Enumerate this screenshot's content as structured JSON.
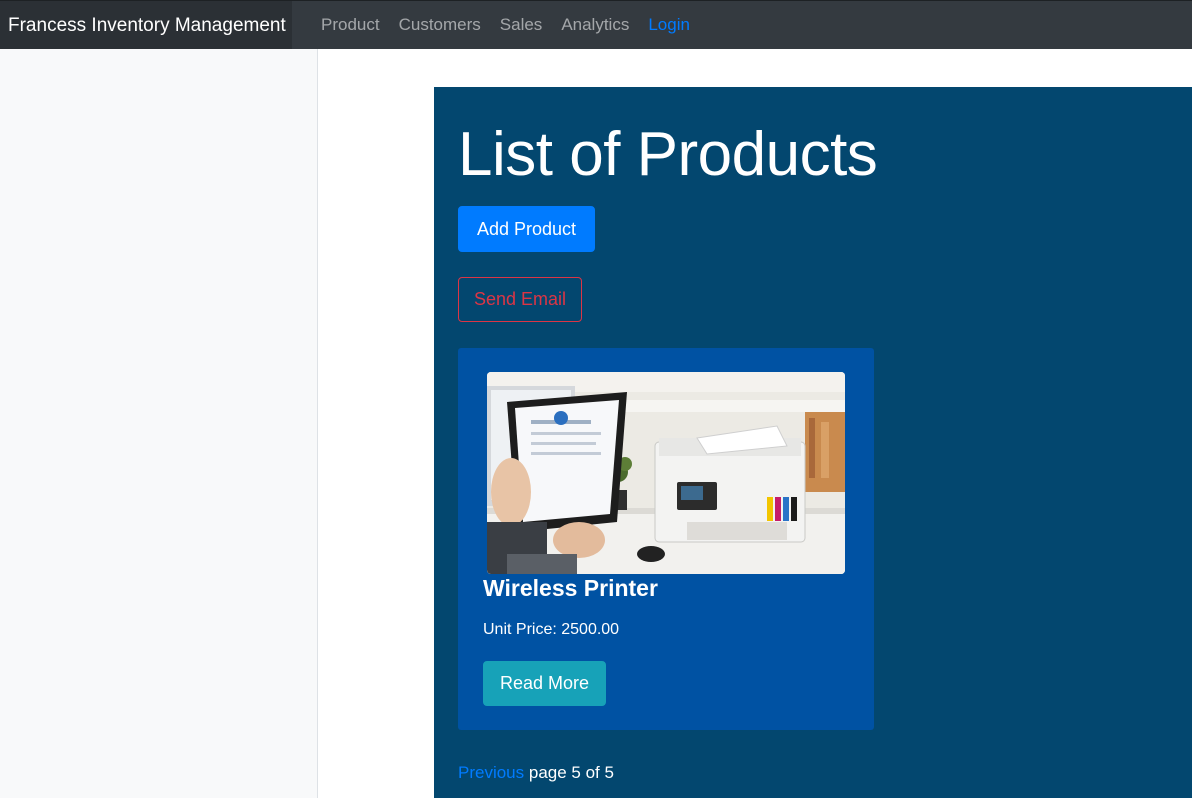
{
  "navbar": {
    "brand": "Francess Inventory Management",
    "links": [
      "Product",
      "Customers",
      "Sales",
      "Analytics"
    ],
    "login": "Login"
  },
  "main": {
    "title": "List of Products",
    "add_button": "Add Product",
    "email_button": "Send Email",
    "cards": [
      {
        "name": "Wireless Printer",
        "price_text": "Unit Price: 2500.00",
        "button": "Read More",
        "image_alt": "printer-photo"
      }
    ],
    "pagination": {
      "previous": "Previous",
      "status": "page 5 of 5"
    }
  },
  "colors": {
    "navbar": "#343a40",
    "panel": "#03476f",
    "card": "#0052a3",
    "primary": "#007bff",
    "danger": "#dc3545",
    "info": "#17a2b8"
  }
}
